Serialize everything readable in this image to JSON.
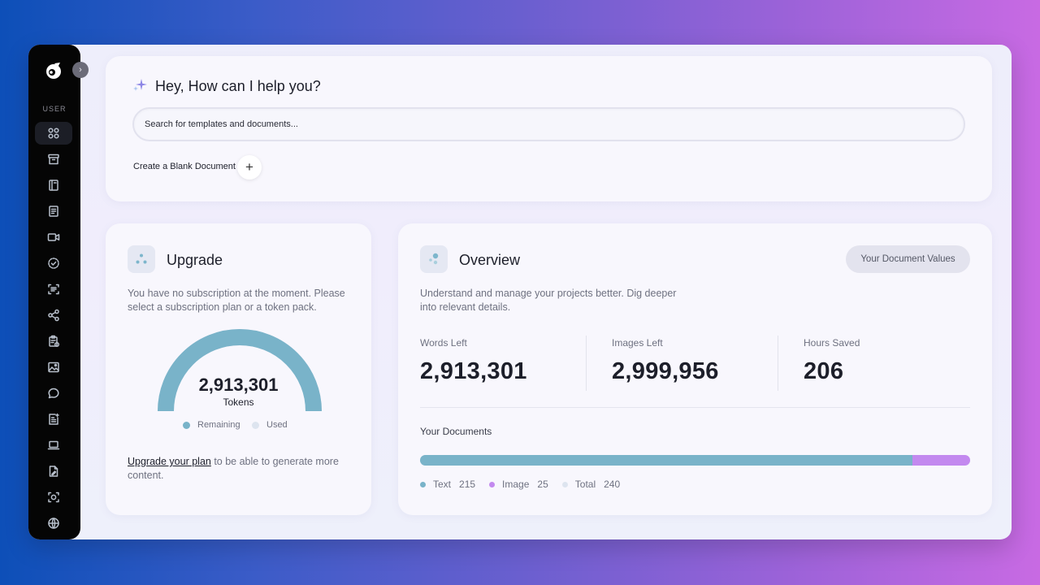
{
  "sidebar": {
    "section_label": "USER",
    "items": [
      {
        "icon": "grid-icon",
        "active": true
      },
      {
        "icon": "archive-icon"
      },
      {
        "icon": "book-icon"
      },
      {
        "icon": "document-icon"
      },
      {
        "icon": "video-icon"
      },
      {
        "icon": "check-circle-icon"
      },
      {
        "icon": "scan-text-icon"
      },
      {
        "icon": "share-icon"
      },
      {
        "icon": "clipboard-icon"
      },
      {
        "icon": "image-icon"
      },
      {
        "icon": "chat-icon"
      },
      {
        "icon": "ai-document-icon"
      },
      {
        "icon": "laptop-icon"
      },
      {
        "icon": "file-edit-icon"
      },
      {
        "icon": "face-scan-icon"
      },
      {
        "icon": "globe-icon"
      }
    ]
  },
  "hero": {
    "title": "Hey, How can I help you?",
    "search_placeholder": "Search for templates and documents...",
    "create_blank_label": "Create a Blank Document",
    "plus_glyph": "+"
  },
  "upgrade": {
    "title": "Upgrade",
    "description": "You have no subscription at the moment. Please select a subscription plan or a token pack.",
    "gauge_value": "2,913,301",
    "gauge_unit": "Tokens",
    "gauge_fill": 1.0,
    "legend_remaining": "Remaining",
    "legend_used": "Used",
    "link_text": "Upgrade your plan",
    "link_suffix": " to be able to generate more content."
  },
  "overview": {
    "title": "Overview",
    "values_button": "Your Document Values",
    "description": "Understand and manage your projects better. Dig deeper into relevant details.",
    "stats": [
      {
        "label": "Words Left",
        "value": "2,913,301"
      },
      {
        "label": "Images Left",
        "value": "2,999,956"
      },
      {
        "label": "Hours Saved",
        "value": "206"
      }
    ],
    "documents_label": "Your Documents",
    "documents": {
      "text": {
        "label": "Text",
        "value": 215
      },
      "image": {
        "label": "Image",
        "value": 25
      },
      "total": {
        "label": "Total",
        "value": 240
      }
    }
  },
  "colors": {
    "teal": "#79b3c9",
    "purple": "#c389ef",
    "track": "#e4e6ef",
    "used_dot": "#dde4ef"
  }
}
